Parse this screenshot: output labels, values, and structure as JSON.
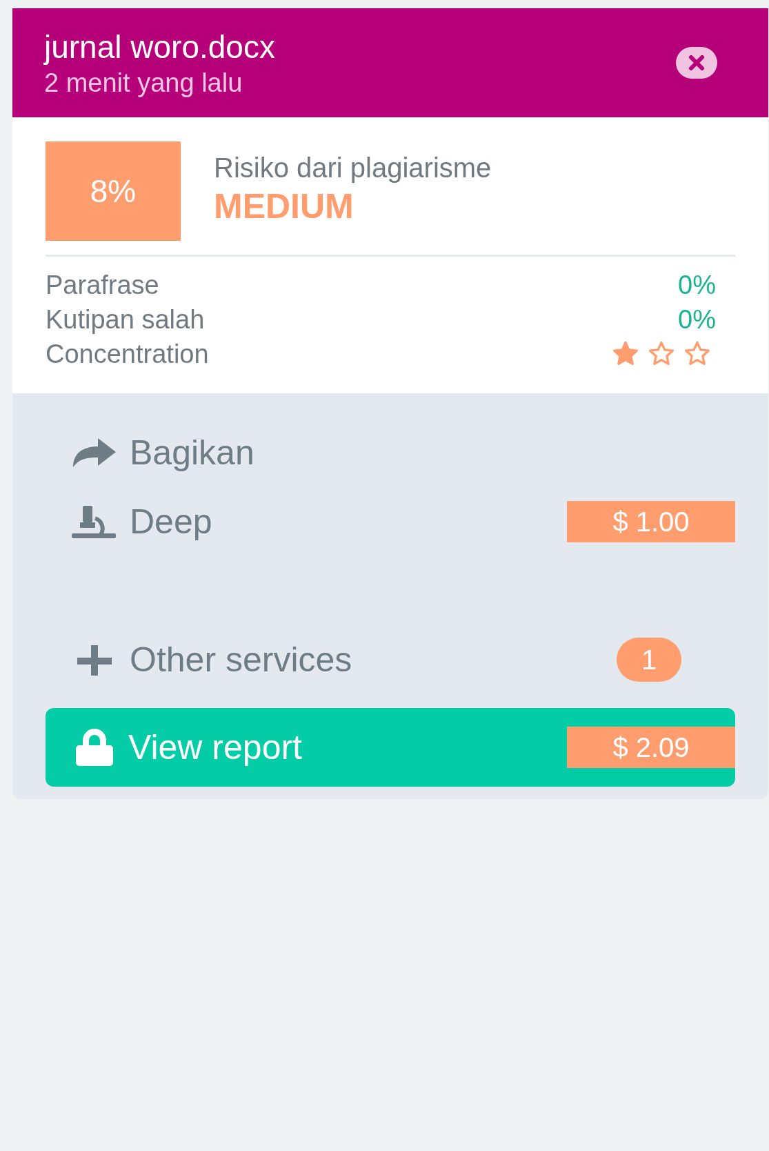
{
  "header": {
    "title": "jurnal woro.docx",
    "subtitle": "2 menit yang lalu"
  },
  "risk": {
    "score": "8%",
    "label": "Risiko dari plagiarisme",
    "level_text": "MEDIUM"
  },
  "metrics": [
    {
      "kind": "percent",
      "label": "Parafrase",
      "value": "0%"
    },
    {
      "kind": "percent",
      "label": "Kutipan salah",
      "value": "0%"
    },
    {
      "kind": "stars",
      "label": "Concentration",
      "stars": 1
    }
  ],
  "actions": [
    {
      "kind": "share",
      "label": "Bagikan"
    },
    {
      "kind": "deep",
      "label": "Deep",
      "price": "1.00",
      "currency": "$"
    },
    {
      "kind": "other",
      "label": "Other services",
      "count": "1"
    }
  ],
  "report": {
    "label": "View report",
    "price": "2.09",
    "currency": "$"
  }
}
